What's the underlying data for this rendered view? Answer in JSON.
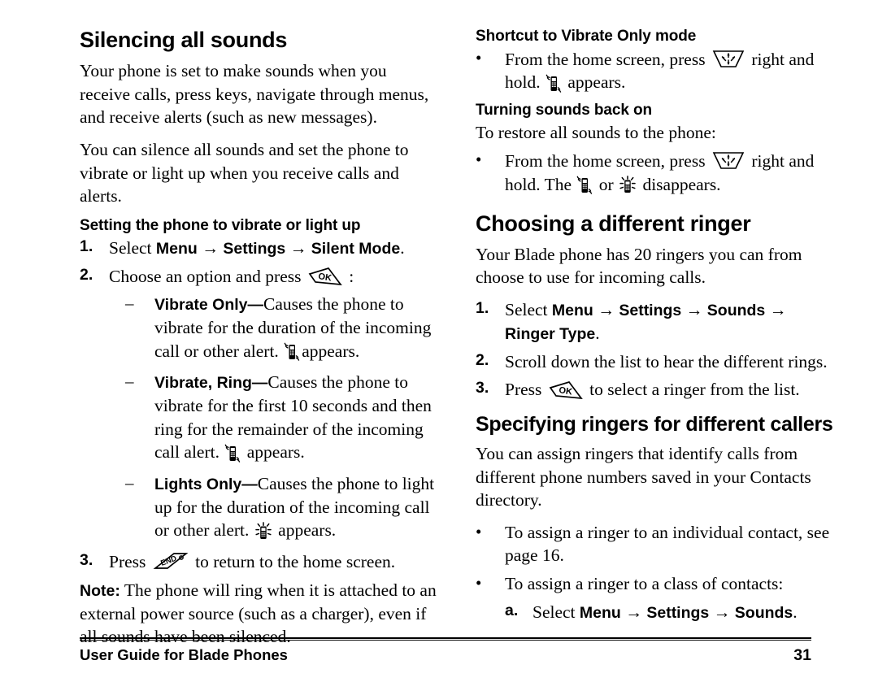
{
  "document": {
    "title": "User Guide for Blade Phones",
    "page_number": "31"
  },
  "left_column": {
    "heading": "Silencing all sounds",
    "intro_paragraph_1": "Your phone is set to make sounds when you receive calls, press keys, navigate through menus, and receive alerts (such as new messages).",
    "intro_paragraph_2": "You can silence all sounds and set the phone to vibrate or light up when you receive calls and alerts.",
    "subheading": "Setting the phone to vibrate or light up",
    "steps": [
      {
        "marker": "1.",
        "prefix": "Select ",
        "ui_1": "Menu",
        "arrow_1": "→",
        "ui_2": "Settings",
        "arrow_2": "→",
        "ui_3": "Silent Mode",
        "suffix": "."
      },
      {
        "marker": "2.",
        "prefix": "Choose an option and press ",
        "icon": "ok-key-icon",
        "suffix": " :"
      },
      {
        "marker": "3.",
        "prefix": "Press ",
        "icon": "end-key-icon",
        "suffix": " to return to the home screen."
      }
    ],
    "options": [
      {
        "marker": "–",
        "term": "Vibrate Only—",
        "description": "Causes the phone to vibrate for the duration of the incoming call or other alert. ",
        "icon": "vibrate-phone-icon",
        "tail": "appears."
      },
      {
        "marker": "–",
        "term": "Vibrate, Ring—",
        "description": "Causes the phone to vibrate for the first 10 seconds and then ring for the remainder of the incoming call alert. ",
        "icon": "vibrate-phone-icon",
        "tail": " appears."
      },
      {
        "marker": "–",
        "term": "Lights Only—",
        "description": "Causes the phone to light up for the duration of the incoming call or other alert. ",
        "icon": "lights-phone-icon",
        "tail": " appears."
      }
    ],
    "note": {
      "label": "Note:",
      "text": " The phone will ring when it is attached to an external power source (such as a charger), even if all sounds have been silenced."
    }
  },
  "right_column": {
    "shortcut_heading": "Shortcut to Vibrate Only mode",
    "shortcut_bullet": {
      "marker": "•",
      "prefix": "From the home screen, press ",
      "nav_icon": "navigation-key-icon",
      "middle": " right and hold. ",
      "status_icon": "vibrate-phone-icon",
      "suffix": " appears."
    },
    "restore_heading": "Turning sounds back on",
    "restore_intro": "To restore all sounds to the phone:",
    "restore_bullet": {
      "marker": "•",
      "prefix": "From the home screen, press ",
      "nav_icon": "navigation-key-icon",
      "middle": " right and hold. The ",
      "status_icon_1": "vibrate-phone-icon",
      "joiner": " or ",
      "status_icon_2": "lights-phone-icon",
      "suffix": " disappears."
    },
    "ringer_heading": "Choosing a different ringer",
    "ringer_intro": "Your Blade phone has 20 ringers you can from choose to use for incoming calls.",
    "ringer_steps": [
      {
        "marker": "1.",
        "prefix": "Select ",
        "ui_1": "Menu",
        "arrow_1": "→",
        "ui_2": "Settings",
        "arrow_2": "→",
        "ui_3": "Sounds",
        "arrow_3": "→",
        "ui_4": "Ringer Type",
        "suffix": "."
      },
      {
        "marker": "2.",
        "text": "Scroll down the list to hear the different rings."
      },
      {
        "marker": "3.",
        "prefix": "Press ",
        "icon": "ok-key-icon",
        "suffix": " to select a ringer from the list."
      }
    ],
    "callers_heading": "Specifying ringers for different callers",
    "callers_intro": "You can assign ringers that identify calls from different phone numbers saved in your Contacts directory.",
    "callers_bullets": [
      {
        "marker": "•",
        "text": "To assign a ringer to an individual contact, see page 16."
      },
      {
        "marker": "•",
        "text": "To assign a ringer to a class of contacts:"
      }
    ],
    "callers_substeps": [
      {
        "marker": "a.",
        "prefix": "Select ",
        "ui_1": "Menu",
        "arrow_1": "→",
        "ui_2": "Settings",
        "arrow_2": "→",
        "ui_3": "Sounds",
        "suffix": "."
      }
    ]
  },
  "colors": {
    "text": "#000000",
    "background": "#ffffff",
    "rule": "#000000"
  }
}
